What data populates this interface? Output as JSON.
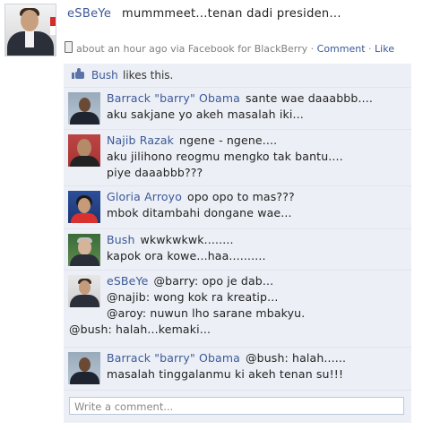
{
  "post": {
    "author": "eSBeYe",
    "status": "mummmeet...tenan dadi presiden...",
    "meta": {
      "time_via": "about an hour ago via Facebook for BlackBerry",
      "comment_link": "Comment",
      "like_link": "Like",
      "separator": "·"
    },
    "likes": {
      "who": "Bush",
      "text": "likes this.",
      "icon": "thumbs-up-icon"
    }
  },
  "comments": [
    {
      "name": "Barrack \"barry\" Obama",
      "lines": [
        "sante wae daaabbb....",
        "aku sakjane yo akeh masalah iki..."
      ]
    },
    {
      "name": "Najib Razak",
      "lines": [
        "ngene - ngene....",
        "aku jilihono reogmu mengko tak bantu....",
        "piye daaabbb???"
      ]
    },
    {
      "name": "Gloria Arroyo",
      "lines": [
        "opo opo to mas???",
        "mbok ditambahi dongane wae..."
      ]
    },
    {
      "name": "Bush",
      "lines": [
        "wkwkwkwk........",
        "kapok ora kowe...haa.........."
      ]
    },
    {
      "name": "eSBeYe",
      "lines": [
        "@barry: opo je dab...",
        "@najib: wong kok ra kreatip...",
        "@aroy: nuwun lho sarane mbakyu.",
        "@bush: halah...kemaki..."
      ]
    },
    {
      "name": "Barrack \"barry\" Obama",
      "lines": [
        "@bush: halah......",
        "masalah tinggalanmu ki akeh tenan su!!!"
      ]
    }
  ],
  "write_comment": {
    "placeholder": "Write a comment..."
  }
}
